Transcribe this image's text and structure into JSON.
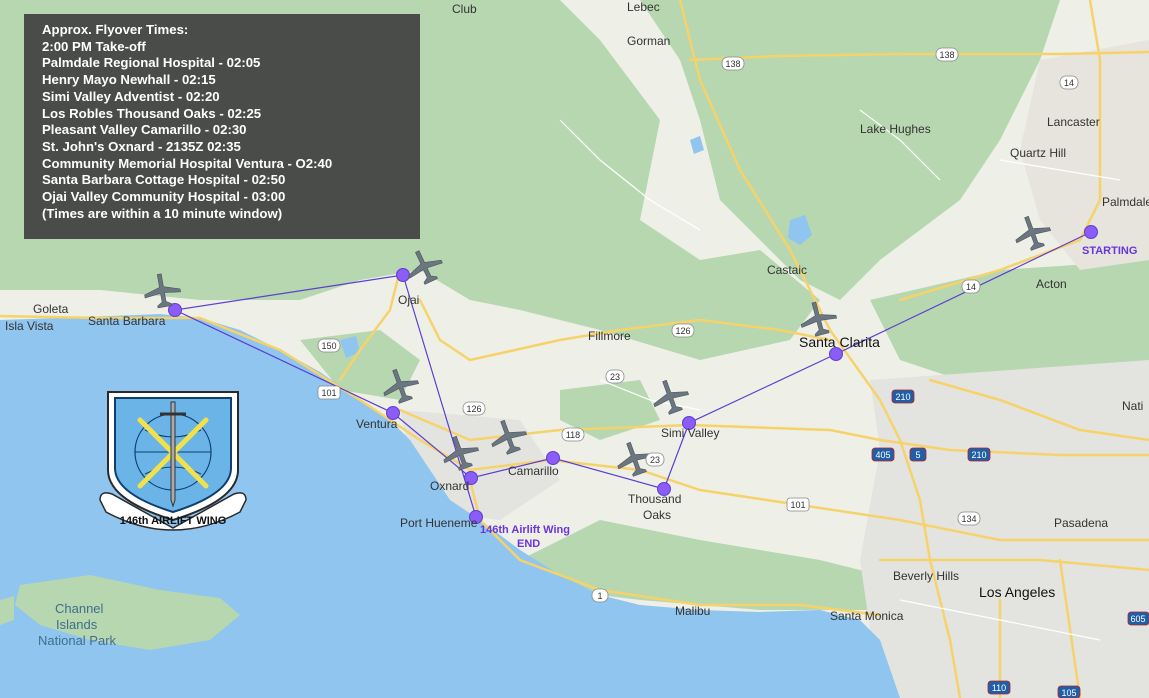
{
  "flyover": {
    "title": "Approx. Flyover Times:",
    "lines": [
      "2:00 PM Take-off",
      "Palmdale Regional Hospital - 02:05",
      "Henry Mayo Newhall - 02:15",
      "Simi Valley Adventist - 02:20",
      "Los Robles Thousand Oaks - 02:25",
      "Pleasant Valley Camarillo - 02:30",
      "St. John's Oxnard - 2135Z 02:35",
      "Community Memorial Hospital Ventura - O2:40",
      "Santa Barbara Cottage Hospital - 02:50",
      "Ojai Valley Community Hospital - 03:00",
      "(Times are within a 10 minute window)"
    ]
  },
  "route": {
    "color": "#5b3fd1",
    "start_label": "STARTING",
    "end_label_1": "146th Airlift Wing",
    "end_label_2": "END"
  },
  "emblem": {
    "text": "146th AIRLIFT WING"
  },
  "places": {
    "lebec": "Lebec",
    "gorman": "Gorman",
    "club": "Club",
    "lancaster": "Lancaster",
    "quartz_hill": "Quartz Hill",
    "palmdale": "Palmdale",
    "lake_hughes": "Lake Hughes",
    "castaic": "Castaic",
    "acton": "Acton",
    "santa_clarita": "Santa Clarita",
    "fillmore": "Fillmore",
    "ojai": "Ojai",
    "goleta": "Goleta",
    "isla_vista": "Isla Vista",
    "santa_barbara": "Santa Barbara",
    "ventura": "Ventura",
    "oxnard": "Oxnard",
    "camarillo": "Camarillo",
    "simi_valley": "Simi Valley",
    "thousand": "Thousand",
    "oaks": "Oaks",
    "port_hueneme": "Port Hueneme",
    "pasadena": "Pasadena",
    "beverly_hills": "Beverly Hills",
    "los_angeles": "Los Angeles",
    "santa_monica": "Santa Monica",
    "malibu": "Malibu",
    "channel": "Channel",
    "islands": "Islands",
    "national_park": "National Park",
    "nati": "Nati"
  },
  "highways": {
    "h138": "138",
    "h138b": "138",
    "h14": "14",
    "h14b": "14",
    "h126": "126",
    "h150": "150",
    "h101a": "101",
    "h126b": "126",
    "h23": "23",
    "h118": "118",
    "h23b": "23",
    "h101b": "101",
    "h1": "1",
    "h210": "210",
    "h405": "405",
    "h5": "5",
    "h210b": "210",
    "h134": "134",
    "h110": "110",
    "h105": "105",
    "h605": "605"
  },
  "colors": {
    "ocean": "#8fc5ef",
    "land": "#eef0e8",
    "mountains": "#b7d7b0",
    "roads": "#f6d36a",
    "route": "#5b3fd1",
    "box": "#404040"
  }
}
